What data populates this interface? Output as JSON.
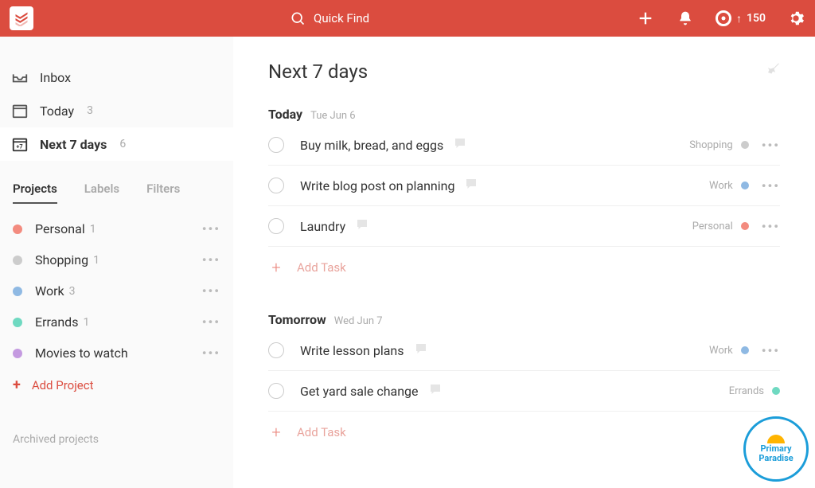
{
  "colors": {
    "brand": "#db4c3f",
    "personal": "#f38b7f",
    "shopping": "#cccccc",
    "work": "#8fb9e3",
    "errands": "#6fd9c1",
    "movies": "#c49ae0"
  },
  "topbar": {
    "search_placeholder": "Quick Find",
    "karma_points": "150"
  },
  "nav": {
    "inbox": "Inbox",
    "today": "Today",
    "today_count": "3",
    "next7": "Next 7 days",
    "next7_count": "6"
  },
  "tabs": {
    "projects": "Projects",
    "labels": "Labels",
    "filters": "Filters"
  },
  "projects": [
    {
      "name": "Personal",
      "count": "1",
      "color": "#f38b7f"
    },
    {
      "name": "Shopping",
      "count": "1",
      "color": "#cccccc"
    },
    {
      "name": "Work",
      "count": "3",
      "color": "#8fb9e3"
    },
    {
      "name": "Errands",
      "count": "1",
      "color": "#6fd9c1"
    },
    {
      "name": "Movies to watch",
      "count": "",
      "color": "#c49ae0"
    }
  ],
  "sidebar": {
    "add_project": "Add Project",
    "archived": "Archived projects"
  },
  "main": {
    "title": "Next 7 days",
    "add_task": "Add Task",
    "days": [
      {
        "label": "Today",
        "date": "Tue Jun 6",
        "tasks": [
          {
            "name": "Buy milk, bread, and eggs",
            "project": "Shopping",
            "color": "#cccccc"
          },
          {
            "name": "Write blog post on planning",
            "project": "Work",
            "color": "#8fb9e3"
          },
          {
            "name": "Laundry",
            "project": "Personal",
            "color": "#f38b7f"
          }
        ]
      },
      {
        "label": "Tomorrow",
        "date": "Wed Jun 7",
        "tasks": [
          {
            "name": "Write lesson plans",
            "project": "Work",
            "color": "#8fb9e3"
          },
          {
            "name": "Get yard sale change",
            "project": "Errands",
            "color": "#6fd9c1"
          }
        ]
      }
    ]
  },
  "watermark": {
    "line1": "Primary",
    "line2": "Paradise"
  }
}
